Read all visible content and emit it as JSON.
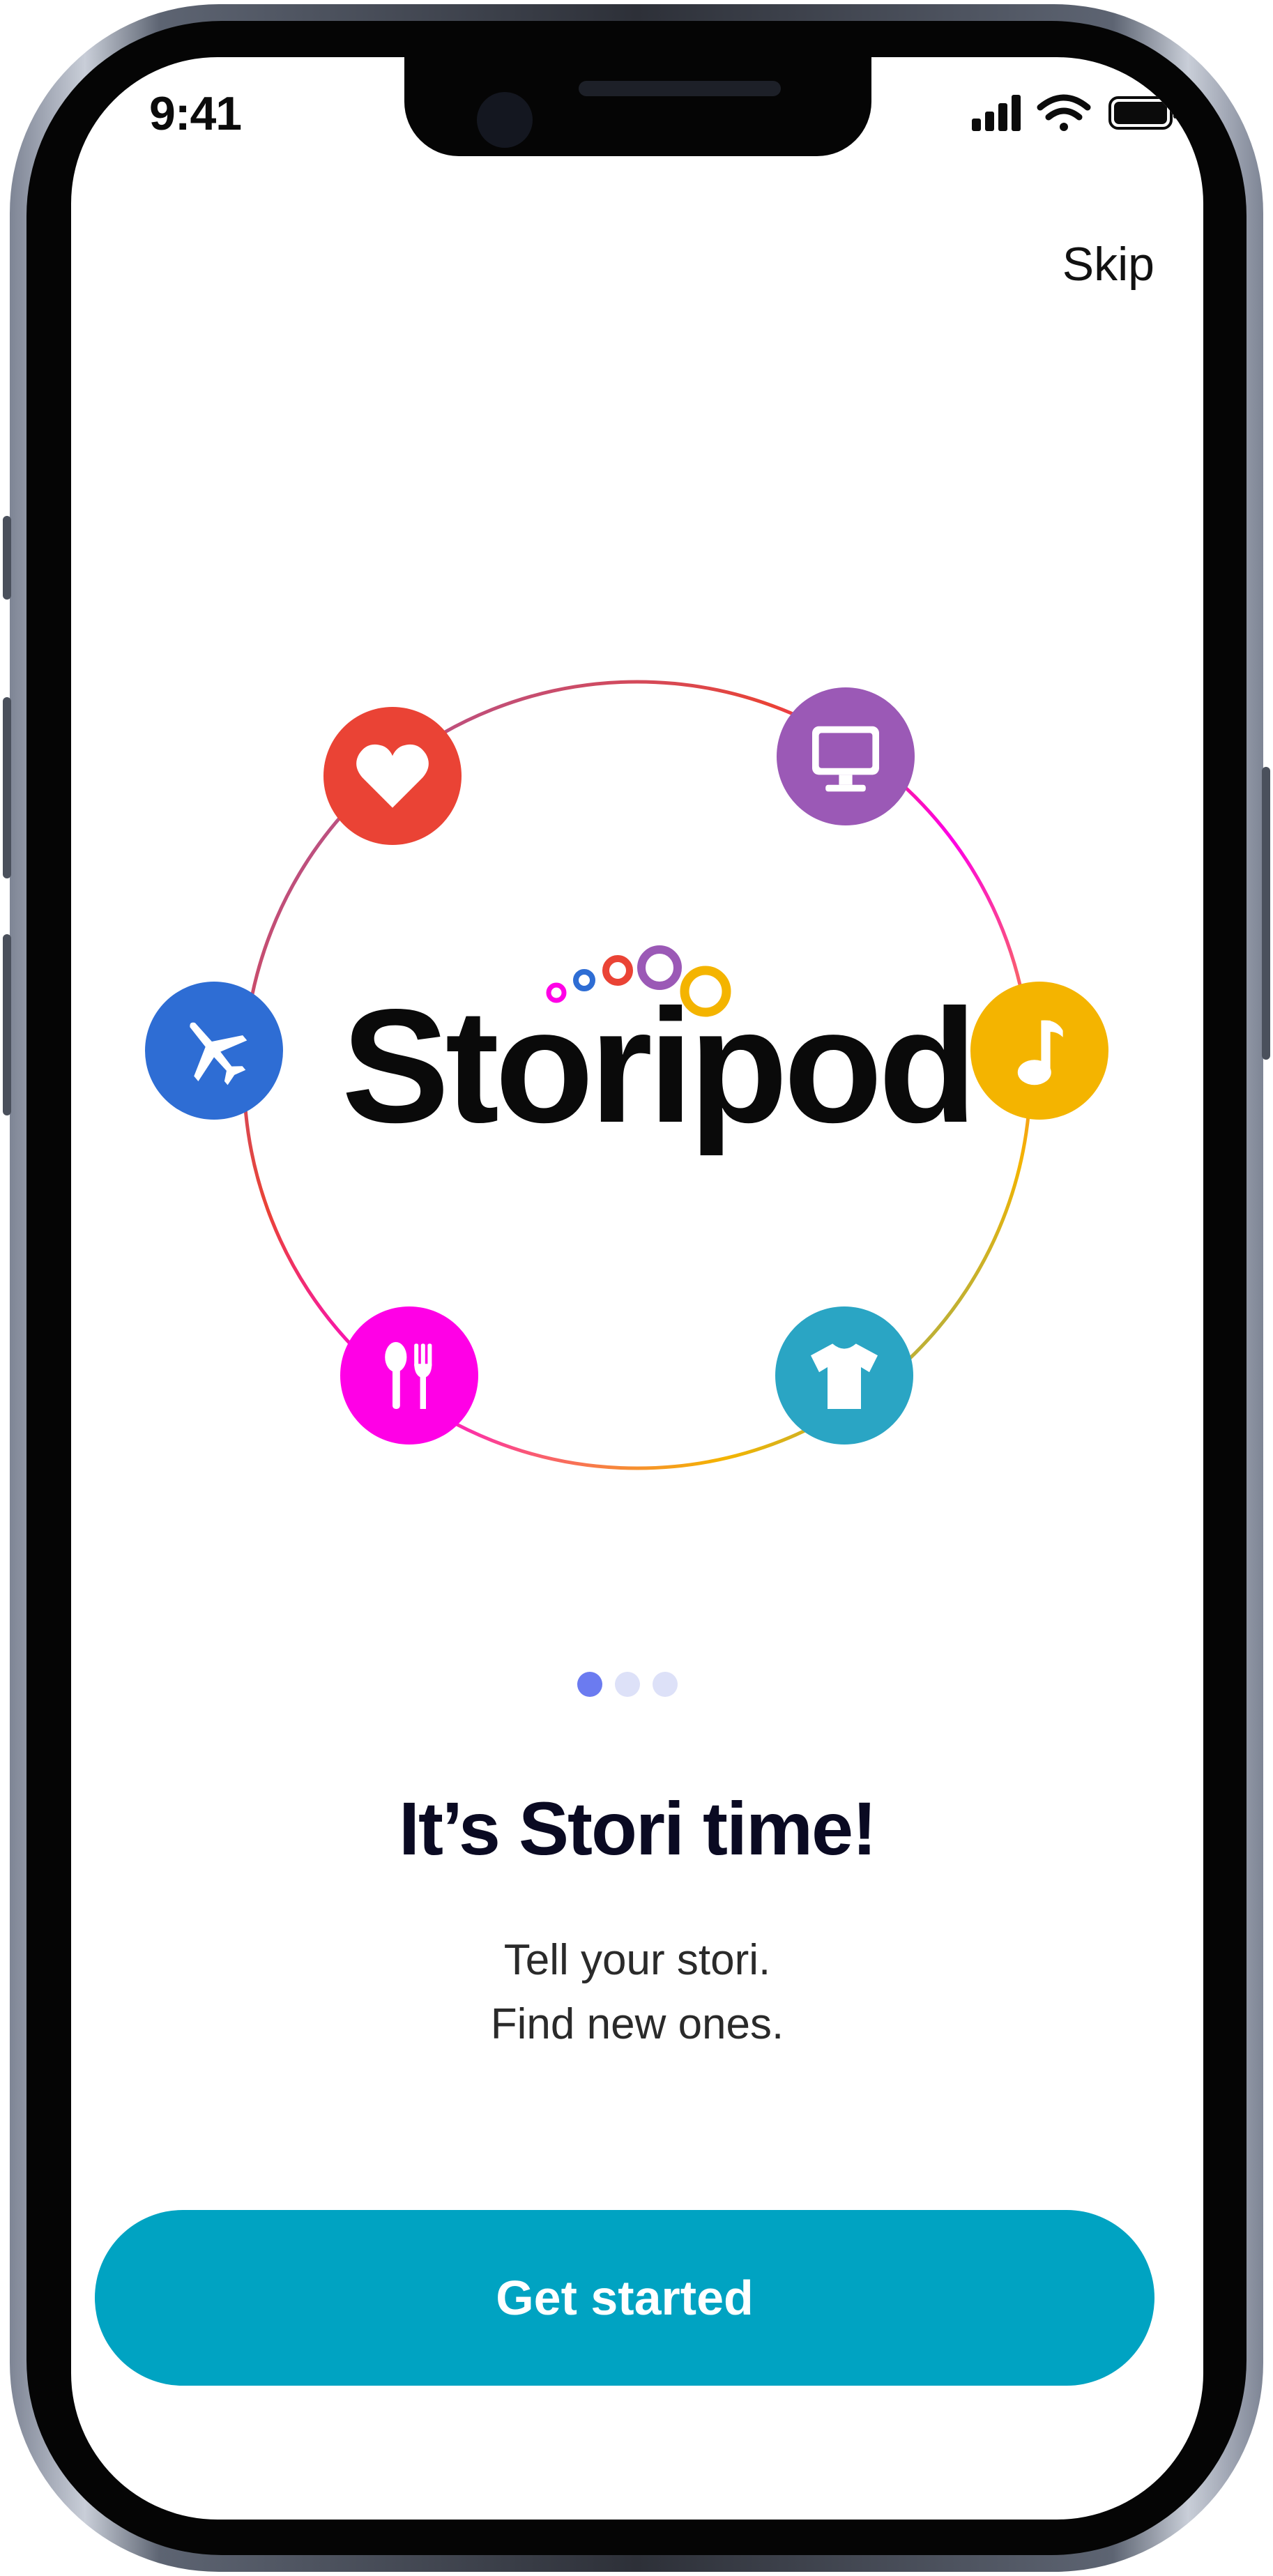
{
  "status_bar": {
    "time": "9:41",
    "icons": [
      "cellular-signal-icon",
      "wifi-icon",
      "battery-icon"
    ]
  },
  "header": {
    "skip_label": "Skip"
  },
  "illustration": {
    "logo_text": "Storipod",
    "category_icons": [
      {
        "name": "heart-icon",
        "color": "#EA4335"
      },
      {
        "name": "monitor-icon",
        "color": "#9B59B6"
      },
      {
        "name": "airplane-icon",
        "color": "#2E6DD4"
      },
      {
        "name": "music-note-icon",
        "color": "#F4B400"
      },
      {
        "name": "fork-spoon-icon",
        "color": "#FF00E6"
      },
      {
        "name": "tshirt-icon",
        "color": "#2AA5C4"
      }
    ]
  },
  "pagination": {
    "total": 3,
    "active_index": 0,
    "active_color": "#6B7BF0",
    "inactive_color": "#DDE1F8"
  },
  "content": {
    "headline": "It’s Stori time!",
    "subtitle_line_1": "Tell your stori.",
    "subtitle_line_2": "Find new ones."
  },
  "cta": {
    "label": "Get started",
    "color": "#00A3C2"
  }
}
